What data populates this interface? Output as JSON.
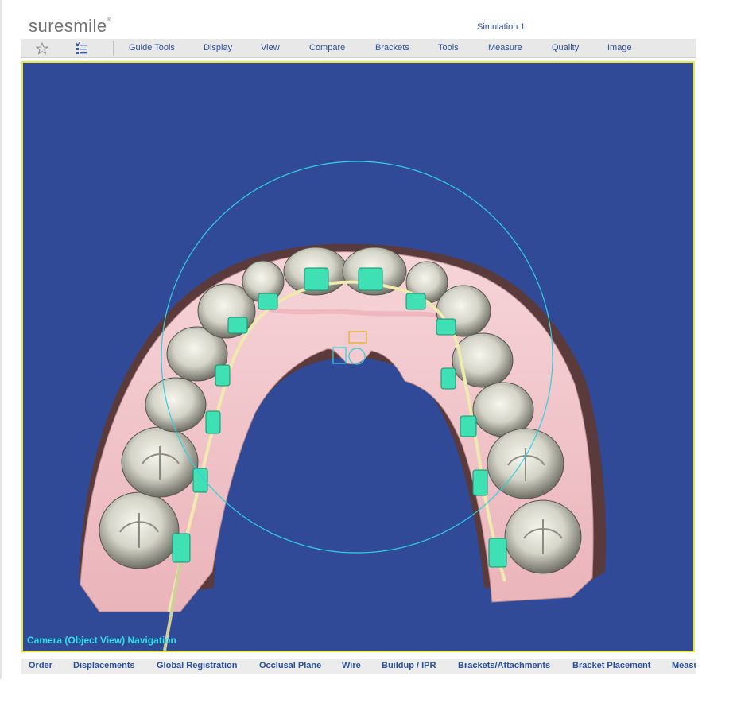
{
  "app": {
    "logo_text": "suresmile",
    "logo_mark": "®",
    "document_title": "Simulation 1"
  },
  "toolbar": {
    "icons": [
      "star-icon",
      "checklist-icon"
    ],
    "menu": [
      "Guide Tools",
      "Display",
      "View",
      "Compare",
      "Brackets",
      "Tools",
      "Measure",
      "Quality",
      "Image"
    ]
  },
  "viewport": {
    "mode_label": "Camera (Object View) Navigation",
    "colors": {
      "background": "#304a98",
      "border": "#e8e840",
      "gingiva": "#f2c4c8",
      "tooth": "#e4e4dc",
      "bracket": "#3fe0b4",
      "wire": "#eeeab0",
      "rotation_circle": "#2fd0e0"
    }
  },
  "bottom_tabs": [
    "Order",
    "Displacements",
    "Global Registration",
    "Occlusal Plane",
    "Wire",
    "Buildup / IPR",
    "Brackets/Attachments",
    "Bracket Placement",
    "Measu"
  ]
}
